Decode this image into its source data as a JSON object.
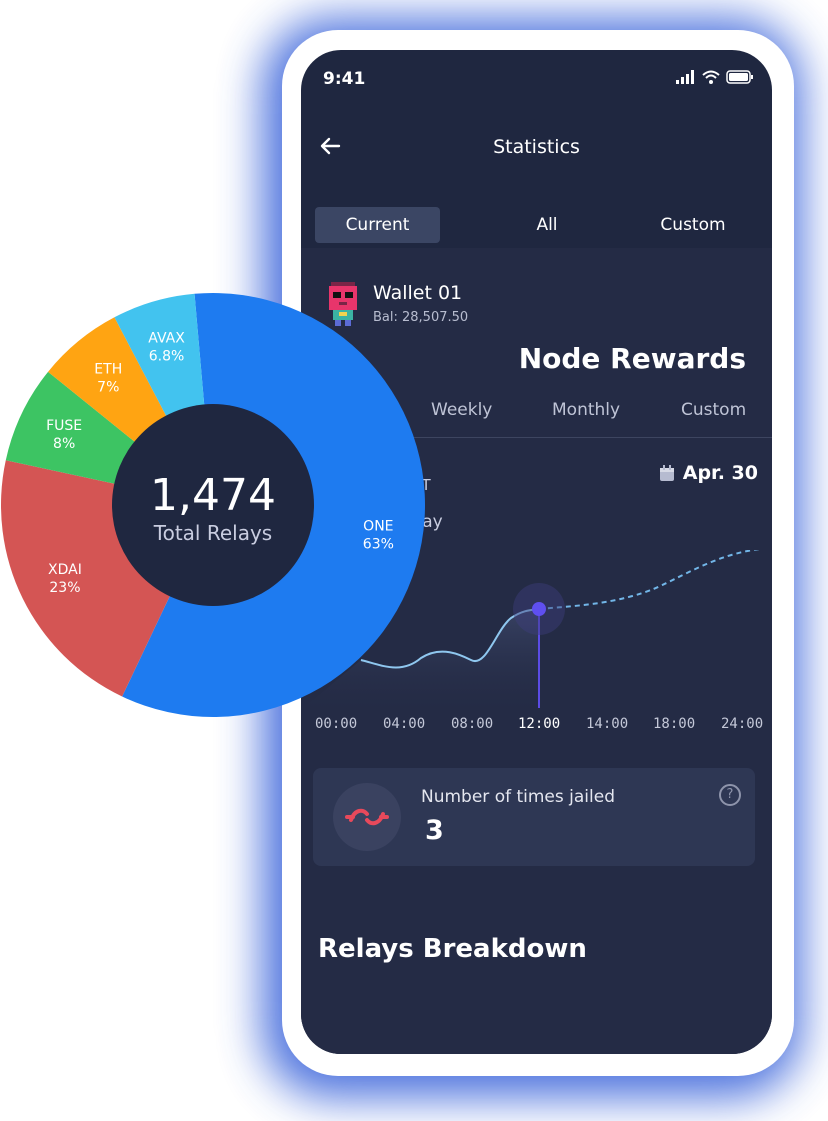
{
  "status_bar": {
    "time": "9:41"
  },
  "header": {
    "title": "Statistics"
  },
  "tabs": [
    {
      "label": "Current"
    },
    {
      "label": "All"
    },
    {
      "label": "Custom"
    }
  ],
  "wallet": {
    "name": "Wallet 01",
    "balance": "Bal: 28,507.50"
  },
  "node_rewards": {
    "title": "Node Rewards",
    "periods": [
      {
        "label": "Weekly"
      },
      {
        "label": "Monthly"
      },
      {
        "label": "Custom"
      }
    ],
    "token_label": "OKT",
    "today_label": "oday",
    "date_label": "Apr. 30",
    "x_ticks": [
      "00:00",
      "04:00",
      "08:00",
      "12:00",
      "14:00",
      "18:00",
      "24:00"
    ],
    "selected_tick": "12:00"
  },
  "jailed": {
    "label": "Number of times jailed",
    "value": "3",
    "help": "?"
  },
  "section": {
    "relays_breakdown": "Relays Breakdown"
  },
  "chart_data": {
    "type": "pie",
    "center_value": "1,474",
    "center_label": "Total Relays",
    "categories": [
      "ONE",
      "XDAI",
      "FUSE",
      "ETH",
      "AVAX"
    ],
    "values": [
      63,
      23,
      8,
      7,
      6.8
    ],
    "value_labels": [
      "63%",
      "23%",
      "8%",
      "7%",
      "6.8%"
    ],
    "colors": [
      "#1e7bf0",
      "#d45554",
      "#3dc463",
      "#ffa412",
      "#42c3ef"
    ]
  }
}
